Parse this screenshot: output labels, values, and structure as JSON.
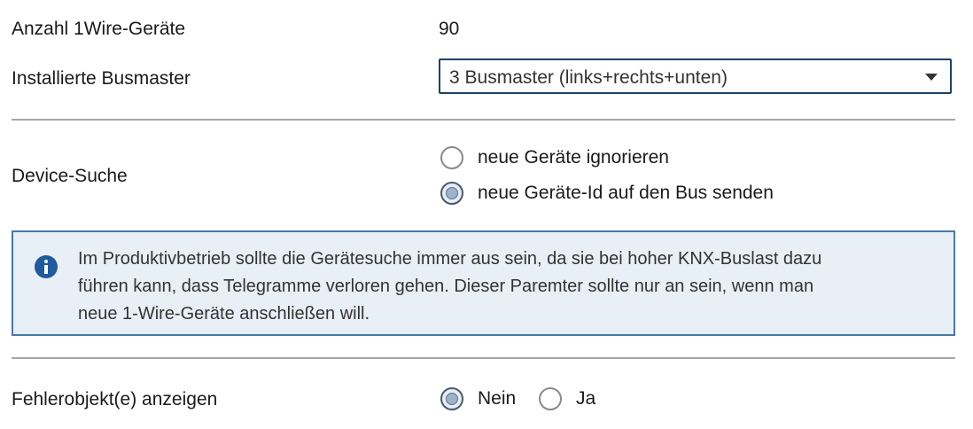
{
  "params": {
    "device_count": {
      "label": "Anzahl 1Wire-Geräte",
      "value": "90"
    },
    "busmaster": {
      "label": "Installierte Busmaster",
      "selected": "3 Busmaster (links+rechts+unten)"
    },
    "device_search": {
      "label": "Device-Suche",
      "options": [
        {
          "label": "neue Geräte ignorieren",
          "checked": false
        },
        {
          "label": "neue Geräte-Id auf den Bus senden",
          "checked": true
        }
      ]
    },
    "info": {
      "icon": "info-icon",
      "lines": [
        "Im Produktivbetrieb sollte die Gerätesuche immer aus sein, da sie bei hoher KNX-Buslast dazu",
        "führen kann, dass Telegramme verloren gehen. Dieser Paremter sollte nur an sein, wenn man",
        "neue 1-Wire-Geräte anschließen will."
      ]
    },
    "error_objects": {
      "label": "Fehlerobjekt(e) anzeigen",
      "options": [
        {
          "label": "Nein",
          "checked": true
        },
        {
          "label": "Ja",
          "checked": false
        }
      ]
    }
  },
  "colors": {
    "select_border": "#1f3f66",
    "info_border": "#4a78a8",
    "info_background": "#e9eff6",
    "info_icon": "#1f5b9e",
    "separator": "#a6a6a6"
  }
}
